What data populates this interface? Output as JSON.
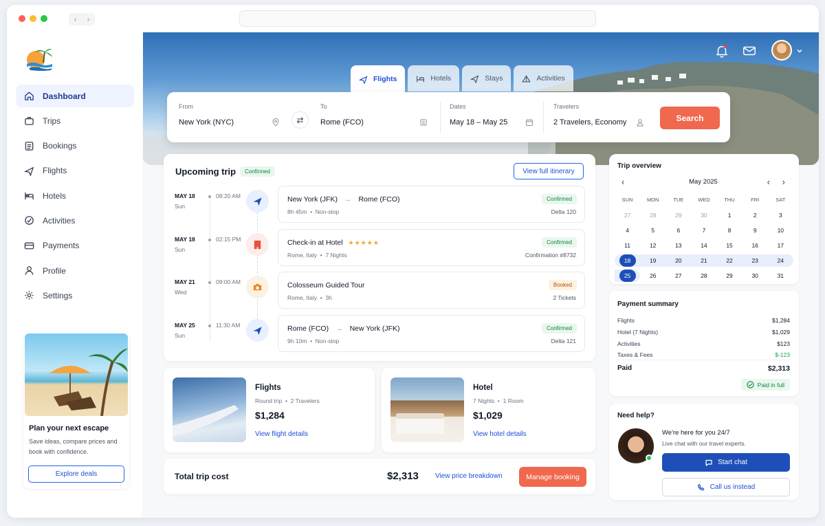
{
  "sidebar": {
    "items": [
      {
        "label": "Dashboard",
        "icon": "home-icon"
      },
      {
        "label": "Trips",
        "icon": "suitcase-icon"
      },
      {
        "label": "Bookings",
        "icon": "list-icon"
      },
      {
        "label": "Flights",
        "icon": "plane-icon"
      },
      {
        "label": "Hotels",
        "icon": "bed-icon"
      },
      {
        "label": "Activities",
        "icon": "compass-icon"
      },
      {
        "label": "Payments",
        "icon": "credit-card-icon"
      },
      {
        "label": "Profile",
        "icon": "user-icon"
      },
      {
        "label": "Settings",
        "icon": "gear-icon"
      }
    ],
    "promo": {
      "title": "Plan your next escape",
      "text": "Save ideas, compare prices and book with confidence.",
      "button": "Explore deals"
    }
  },
  "tabs": [
    "Flights",
    "Hotels",
    "Stays",
    "Activities"
  ],
  "search": {
    "from_label": "From",
    "from_value": "New York (NYC)",
    "to_label": "To",
    "to_value": "Rome (FCO)",
    "dates_label": "Dates",
    "dates_value": "May 18 – May 25",
    "travelers_label": "Travelers",
    "travelers_value": "2 Travelers, Economy",
    "button": "Search"
  },
  "upcoming": {
    "title": "Upcoming trip",
    "status": "Confirmed",
    "itinerary_button": "View full itinerary",
    "items": [
      {
        "date": "MAY 18",
        "day": "Sun",
        "time": "08:20 AM",
        "title_from": "New York (JFK)",
        "title_to": "Rome (FCO)",
        "detail_a": "8h 45m",
        "detail_b": "Non-stop",
        "badge": "Confirmed",
        "right": "Delta 120"
      },
      {
        "date": "MAY 18",
        "day": "Sun",
        "time": "02:15 PM",
        "title": "Check-in at Hotel",
        "detail_a": "Rome, Italy",
        "detail_b": "7 Nights",
        "badge": "Confirmed",
        "right": "Confirmation #8732"
      },
      {
        "date": "MAY 21",
        "day": "Wed",
        "time": "09:00 AM",
        "title": "Colosseum Guided Tour",
        "detail_a": "Rome, Italy",
        "detail_b": "3h",
        "badge": "Booked",
        "right": "2 Tickets"
      },
      {
        "date": "MAY 25",
        "day": "Sun",
        "time": "11:30 AM",
        "title_from": "Rome (FCO)",
        "title_to": "New York (JFK)",
        "detail_a": "9h 10m",
        "detail_b": "Non-stop",
        "badge": "Confirmed",
        "right": "Delta 121"
      }
    ]
  },
  "flights_card": {
    "title": "Flights",
    "sub_a": "Round trip",
    "sub_b": "2 Travelers",
    "price": "$1,284",
    "link": "View flight details"
  },
  "hotel_card": {
    "title": "Hotel",
    "sub_a": "7 Nights",
    "sub_b": "1 Room",
    "price": "$1,029",
    "link": "View hotel details"
  },
  "total": {
    "label": "Total trip cost",
    "amount": "$2,313",
    "link": "View price breakdown",
    "button": "Manage booking"
  },
  "overview": {
    "title": "Trip overview",
    "month": "May 2025",
    "dow": [
      "SUN",
      "MON",
      "TUE",
      "WED",
      "THU",
      "FRI",
      "SAT"
    ],
    "weeks": [
      [
        "27",
        "28",
        "29",
        "30",
        "1",
        "2",
        "3"
      ],
      [
        "4",
        "5",
        "6",
        "7",
        "8",
        "9",
        "10"
      ],
      [
        "11",
        "12",
        "13",
        "14",
        "15",
        "16",
        "17"
      ],
      [
        "18",
        "19",
        "20",
        "21",
        "22",
        "23",
        "24"
      ],
      [
        "25",
        "26",
        "27",
        "28",
        "29",
        "30",
        "31"
      ]
    ],
    "selected": [
      "18",
      "25"
    ]
  },
  "payment": {
    "title": "Payment summary",
    "lines": [
      {
        "label": "Flights",
        "value": "$1,284"
      },
      {
        "label": "Hotel (7 Nights)",
        "value": "$1,029"
      },
      {
        "label": "Activities",
        "value": "$123"
      },
      {
        "label": "Taxes & Fees",
        "value": "$-123"
      }
    ],
    "paid_label": "Paid",
    "paid_value": "$2,313",
    "badge": "Paid in full"
  },
  "help": {
    "title": "Need help?",
    "headline": "We're here for you 24/7",
    "sub": "Live chat with our travel experts.",
    "chat_button": "Start chat",
    "call_button": "Call us instead"
  },
  "colors": {
    "accent": "#1e4fb8",
    "cta": "#f0684e",
    "success": "#15803d"
  }
}
